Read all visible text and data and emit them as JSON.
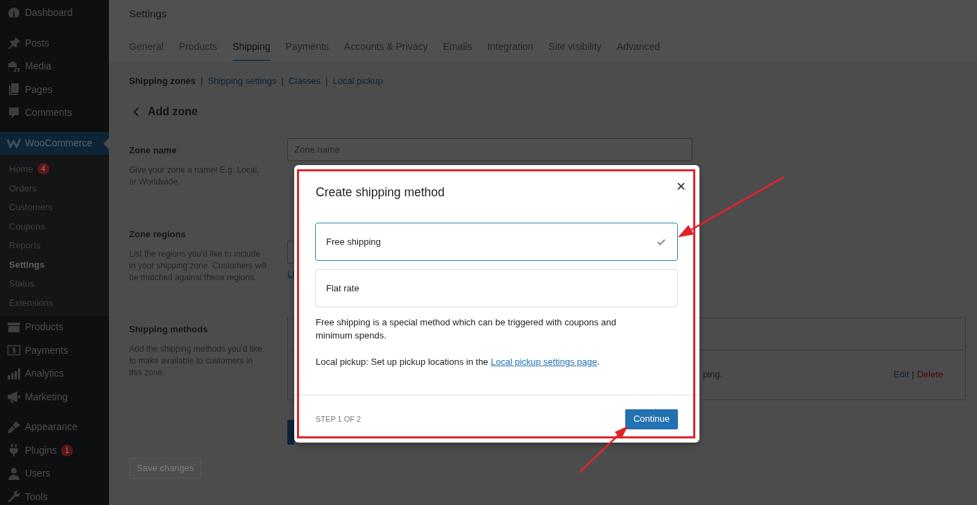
{
  "sidebar": {
    "groups": [
      {
        "items": [
          {
            "label": "Dashboard",
            "selected": false
          }
        ]
      },
      {
        "items": [
          {
            "label": "Posts",
            "selected": false
          },
          {
            "label": "Media",
            "selected": false
          },
          {
            "label": "Pages",
            "selected": false
          },
          {
            "label": "Comments",
            "selected": false
          }
        ]
      },
      {
        "items": [
          {
            "label": "WooCommerce",
            "selected": true,
            "children": [
              {
                "label": "Home",
                "badge": "4",
                "selected": false
              },
              {
                "label": "Orders",
                "selected": false
              },
              {
                "label": "Customers",
                "selected": false
              },
              {
                "label": "Coupons",
                "selected": false
              },
              {
                "label": "Reports",
                "selected": false
              },
              {
                "label": "Settings",
                "selected": true
              },
              {
                "label": "Status",
                "selected": false
              },
              {
                "label": "Extensions",
                "selected": false
              }
            ]
          },
          {
            "label": "Products",
            "selected": false
          },
          {
            "label": "Payments",
            "selected": false
          },
          {
            "label": "Analytics",
            "selected": false
          },
          {
            "label": "Marketing",
            "selected": false
          }
        ]
      },
      {
        "items": [
          {
            "label": "Appearance",
            "selected": false
          },
          {
            "label": "Plugins",
            "badge": "1",
            "selected": false
          },
          {
            "label": "Users",
            "selected": false
          },
          {
            "label": "Tools",
            "selected": false
          }
        ]
      }
    ]
  },
  "header": {
    "title": "Settings",
    "tabs": [
      {
        "label": "General",
        "selected": false
      },
      {
        "label": "Products",
        "selected": false
      },
      {
        "label": "Shipping",
        "selected": true
      },
      {
        "label": "Payments",
        "selected": false
      },
      {
        "label": "Accounts & Privacy",
        "selected": false
      },
      {
        "label": "Emails",
        "selected": false
      },
      {
        "label": "Integration",
        "selected": false
      },
      {
        "label": "Site visibility",
        "selected": false
      },
      {
        "label": "Advanced",
        "selected": false
      }
    ]
  },
  "subnav": {
    "separator": "|",
    "items": [
      {
        "label": "Shipping zones",
        "selected": true
      },
      {
        "label": "Shipping settings",
        "selected": false
      },
      {
        "label": "Classes",
        "selected": false
      },
      {
        "label": "Local pickup",
        "selected": false
      }
    ]
  },
  "back": {
    "label": "Add zone"
  },
  "sections": [
    {
      "kind": "name",
      "title": "Zone name",
      "description": "Give your zone a name! E.g. Local, or Worldwide.",
      "field": {
        "placeholder": "Zone name"
      }
    },
    {
      "kind": "regions",
      "title": "Zone regions",
      "description": "List the regions you'd like to include in your shipping zone. Customers will be matched against these regions.",
      "link": "Li"
    },
    {
      "kind": "methods",
      "title": "Shipping methods",
      "description": "Add the shipping methods you'd like to make available to customers in this zone.",
      "row": {
        "text": "ping.",
        "separator": "|",
        "actions": [
          {
            "kind": "edit",
            "label": "Edit"
          },
          {
            "kind": "delete",
            "label": "Delete"
          }
        ]
      }
    }
  ],
  "save_button": {
    "label": "Save changes",
    "disabled": true
  },
  "modal": {
    "title": "Create shipping method",
    "options": [
      {
        "label": "Free shipping",
        "selected": true
      },
      {
        "label": "Flat rate",
        "selected": false
      }
    ],
    "notes": [
      {
        "text": "Free shipping is a special method which can be triggered with coupons and minimum spends."
      },
      {
        "text": "Local pickup: Set up pickup locations in the ",
        "link": "Local pickup settings page",
        "tail": "."
      }
    ],
    "step": "STEP 1 OF 2",
    "button": "Continue"
  },
  "annotations": [
    {
      "kind": "frame"
    },
    {
      "kind": "arrow"
    },
    {
      "kind": "arrow"
    }
  ]
}
